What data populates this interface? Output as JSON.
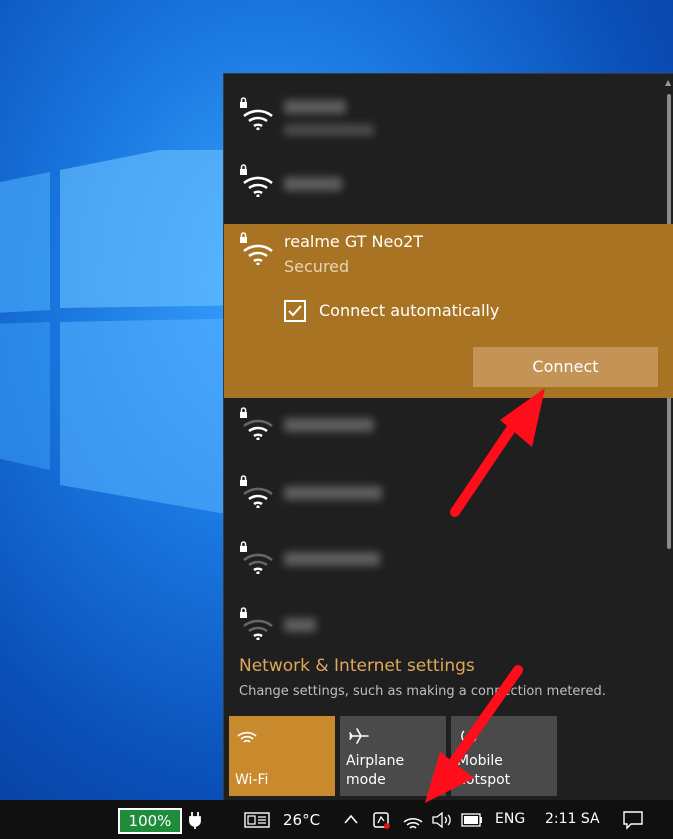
{
  "networks": {
    "top": [
      {
        "locked": true
      },
      {
        "locked": true
      }
    ],
    "selected": {
      "name": "realme GT Neo2T",
      "status": "Secured",
      "auto_connect_label": "Connect automatically",
      "auto_connect_checked": true,
      "connect_label": "Connect"
    },
    "bottom": [
      {
        "locked": true
      },
      {
        "locked": true
      },
      {
        "locked": true
      },
      {
        "locked": true
      }
    ]
  },
  "settings": {
    "link": "Network & Internet settings",
    "description": "Change settings, such as making a connection metered."
  },
  "quick_actions": [
    {
      "label": "Wi-Fi",
      "icon": "wifi-icon",
      "active": true
    },
    {
      "label": "Airplane mode",
      "icon": "airplane-icon",
      "active": false
    },
    {
      "label": "Mobile hotspot",
      "icon": "hotspot-icon",
      "active": false
    }
  ],
  "taskbar": {
    "battery": "100%",
    "weather": "26°C",
    "language": "ENG",
    "time": "2:11 SA"
  },
  "colors": {
    "accent": "#a87424",
    "accent_tile": "#c98a2e",
    "flyout_bg": "#1f1f1f",
    "link": "#e0a85c",
    "battery_green": "#1e8c3a",
    "annotation": "#ff0d1a"
  }
}
